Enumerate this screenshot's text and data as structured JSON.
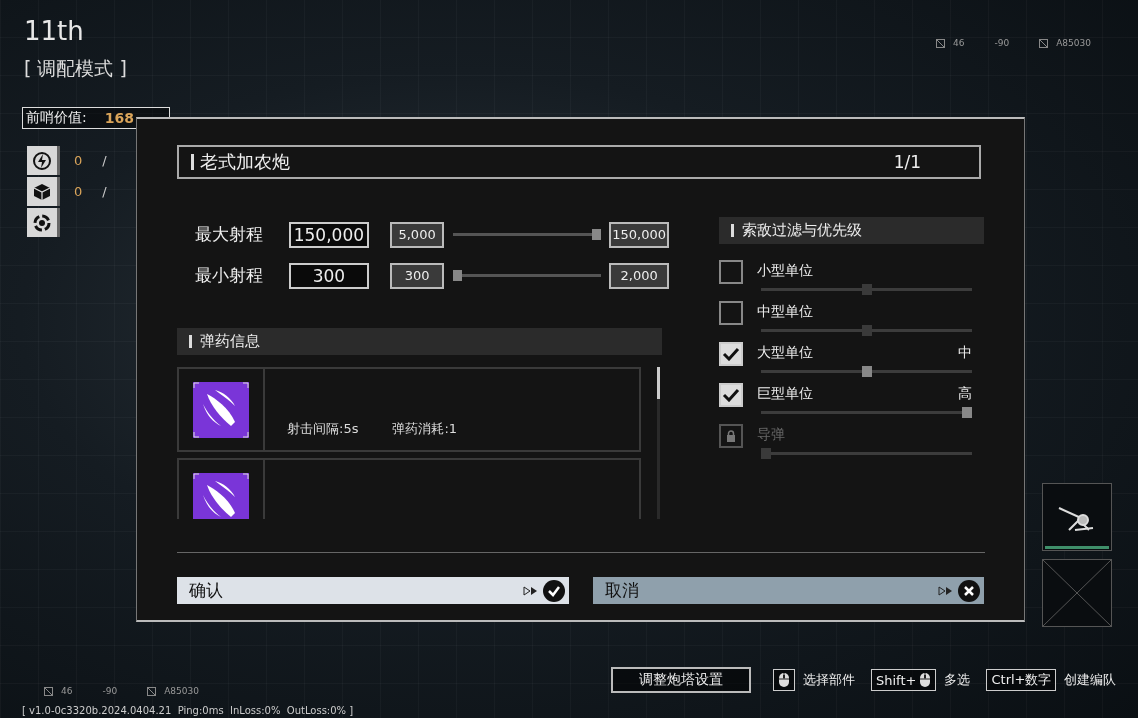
{
  "hud": {
    "rank": "11th",
    "mode": "[ 调配模式 ]",
    "outpost_value": {
      "label": "前哨价值:",
      "value": "168"
    },
    "resources": [
      {
        "kind": "energy",
        "current": "0",
        "separator": "/"
      },
      {
        "kind": "cube",
        "current": "0",
        "separator": "/"
      },
      {
        "kind": "ring"
      }
    ]
  },
  "coords_top": [
    {
      "text": "46",
      "icon": true
    },
    {
      "text": "-90",
      "icon": false
    },
    {
      "text": "A85030",
      "icon": true
    }
  ],
  "dialog": {
    "title": "老式加农炮",
    "counter": "1/1",
    "ranges": [
      {
        "label": "最大射程",
        "value": "150,000",
        "min": "5,000",
        "max": "150,000",
        "level": 1
      },
      {
        "label": "最小射程",
        "value": "300",
        "min": "300",
        "max": "2,000",
        "level": 0
      }
    ],
    "ammo": {
      "title": "弹药信息",
      "items": [
        {
          "kind": "rocket",
          "stats": [
            "射击间隔:5s",
            "弹药消耗:1"
          ]
        },
        {
          "kind": "rocket"
        }
      ]
    },
    "filter": {
      "title": "索敌过滤与优先级",
      "items": [
        {
          "kind": "checkbox",
          "label": "小型单位",
          "checked": false,
          "locked": false,
          "level": 0.5
        },
        {
          "kind": "checkbox",
          "label": "中型单位",
          "checked": false,
          "locked": false,
          "level": 0.5
        },
        {
          "kind": "checkbox",
          "label": "大型单位",
          "checked": true,
          "locked": false,
          "priority": "中",
          "level": 0.5
        },
        {
          "kind": "checkbox",
          "label": "巨型单位",
          "checked": true,
          "locked": false,
          "priority": "高",
          "level": 1
        },
        {
          "kind": "locked",
          "label": "导弹",
          "locked": true,
          "level": 0
        }
      ]
    },
    "buttons": [
      {
        "kind": "confirm",
        "label": "确认"
      },
      {
        "kind": "cancel",
        "label": "取消"
      }
    ]
  },
  "slots": [
    {
      "kind": "turret"
    },
    {
      "kind": "empty"
    }
  ],
  "footer": {
    "coords": [
      {
        "text": "46",
        "icon": true
      },
      {
        "text": "-90",
        "icon": false
      },
      {
        "text": "A85030",
        "icon": true
      }
    ],
    "version": "[ v1.0-0c3320b.2024.0404.21  Ping:0ms  InLoss:0%  OutLoss:0% ]",
    "controls": [
      {
        "kind": "button",
        "label": "调整炮塔设置"
      },
      {
        "kind": "mouse",
        "label": "选择部件"
      },
      {
        "kind": "key",
        "key": "Shift+",
        "mouse": true,
        "label": "多选"
      },
      {
        "kind": "key",
        "key": "Ctrl+数字",
        "mouse": false,
        "label": "创建编队"
      }
    ]
  }
}
